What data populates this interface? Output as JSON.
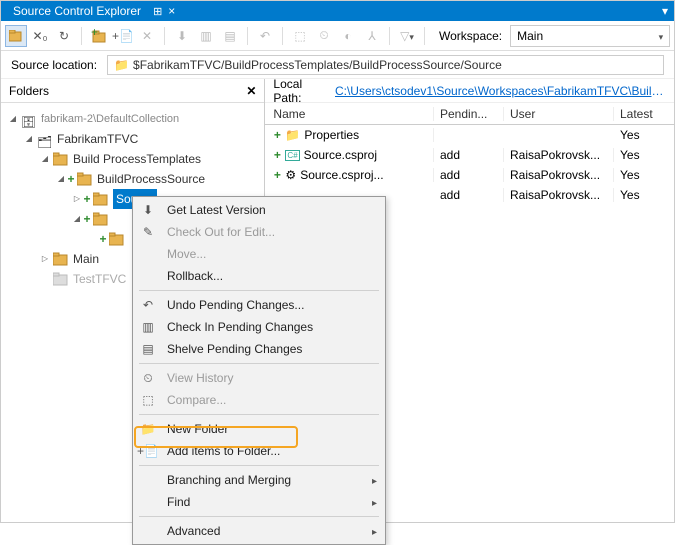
{
  "title": "Source Control Explorer",
  "workspace_label": "Workspace:",
  "workspace_value": "Main",
  "source_location_label": "Source location:",
  "source_location_value": "$FabrikamTFVC/BuildProcessTemplates/BuildProcessSource/Source",
  "folders_header": "Folders",
  "tree": {
    "root": "fabrikam-2\\DefaultCollection",
    "n1": "FabrikamTFVC",
    "n2": "Build ProcessTemplates",
    "n3": "BuildProcessSource",
    "n4": "Source",
    "n5": "Main",
    "n6": "TestTFVC"
  },
  "local_path_label": "Local Path:",
  "local_path_value": "C:\\Users\\ctsodev1\\Source\\Workspaces\\FabrikamTFVC\\BuildProc...",
  "cols": {
    "name": "Name",
    "pending": "Pendin...",
    "user": "User",
    "latest": "Latest"
  },
  "rows": [
    {
      "name": "Properties",
      "pending": "",
      "user": "",
      "latest": "Yes"
    },
    {
      "name": "Source.csproj",
      "pending": "add",
      "user": "RaisaPokrovsk...",
      "latest": "Yes"
    },
    {
      "name": "Source.csproj...",
      "pending": "add",
      "user": "RaisaPokrovsk...",
      "latest": "Yes"
    },
    {
      "name": "",
      "pending": "add",
      "user": "RaisaPokrovsk...",
      "latest": "Yes"
    }
  ],
  "menu": {
    "getlatest": "Get Latest Version",
    "checkout": "Check Out for Edit...",
    "move": "Move...",
    "rollback": "Rollback...",
    "undo": "Undo Pending Changes...",
    "checkin": "Check In Pending Changes",
    "shelve": "Shelve Pending Changes",
    "history": "View History",
    "compare": "Compare...",
    "newfolder": "New Folder",
    "additems": "Add items to Folder...",
    "branching": "Branching and Merging",
    "find": "Find",
    "advanced": "Advanced"
  }
}
